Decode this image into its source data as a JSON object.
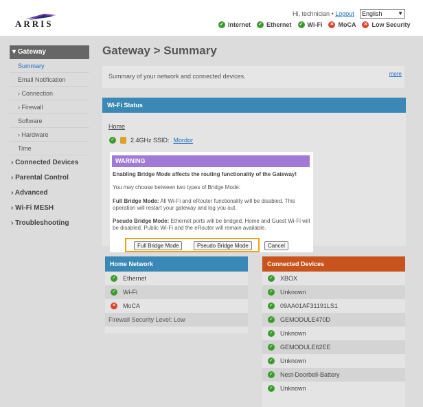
{
  "header": {
    "logo_text": "ARRIS",
    "greeting": "Hi, technician",
    "logout": "Logout",
    "language": "English",
    "status": [
      {
        "label": "Internet",
        "state": "ok"
      },
      {
        "label": "Ethernet",
        "state": "ok"
      },
      {
        "label": "Wi-Fi",
        "state": "ok"
      },
      {
        "label": "MoCA",
        "state": "error"
      },
      {
        "label": "Low Security",
        "state": "error"
      }
    ]
  },
  "sidebar": {
    "active_section": "Gateway",
    "gateway_items": [
      {
        "label": "Summary",
        "current": true
      },
      {
        "label": "Email Notification"
      },
      {
        "label": "Connection",
        "expandable": true
      },
      {
        "label": "Firewall",
        "expandable": true
      },
      {
        "label": "Software"
      },
      {
        "label": "Hardware",
        "expandable": true
      },
      {
        "label": "Time"
      }
    ],
    "sections": [
      "Connected Devices",
      "Parental Control",
      "Advanced",
      "Wi-Fi MESH",
      "Troubleshooting"
    ]
  },
  "page": {
    "title": "Gateway > Summary",
    "summary_text": "Summary of your network and connected devices.",
    "more": "more"
  },
  "wifi_status": {
    "heading": "Wi-Fi Status",
    "home_link": "Home",
    "band_label": "2.4GHz SSID:",
    "ssid": "Mordor"
  },
  "home_network": {
    "heading": "Home Network",
    "items": [
      {
        "label": "Ethernet",
        "state": "ok"
      },
      {
        "label": "Wi-Fi",
        "state": "ok"
      },
      {
        "label": "MoCA",
        "state": "error"
      }
    ],
    "security_label": "Firewall Security Level:",
    "security_value": "Low"
  },
  "connected_devices": {
    "heading": "Connected Devices",
    "items": [
      "XBOX",
      "Unknown",
      "09AA01AF31191LS1",
      "GEMODULE470D",
      "Unknown",
      "GEMODULE62EE",
      "Unknown",
      "Nest-Doorbell-Battery",
      "Unknown"
    ]
  },
  "modal": {
    "warning": "WARNING",
    "title": "Enabling Bridge Mode affects the routing functionality of the Gateway!",
    "intro": "You may choose between two types of Bridge Mode:",
    "full_label": "Full Bridge Mode:",
    "full_text": "All Wi-Fi and eRouter functionality will be disabled. This operation will restart your gateway and log you out.",
    "pseudo_label": "Pseudo Bridge Mode:",
    "pseudo_text": "Ethernet ports will be bridged. Home and Guest Wi-Fi will be disabled. Public Wi-Fi and the eRouter will remain available.",
    "btn_full": "Full Bridge Mode",
    "btn_pseudo": "Pseudo Bridge Mode",
    "btn_cancel": "Cancel"
  },
  "colors": {
    "ok": "#3d9a2f",
    "error": "#d9452b",
    "accent_blue": "#3a88b5",
    "accent_orange": "#c9531c",
    "warning": "#a07ad4",
    "highlight": "#f0a21a"
  }
}
